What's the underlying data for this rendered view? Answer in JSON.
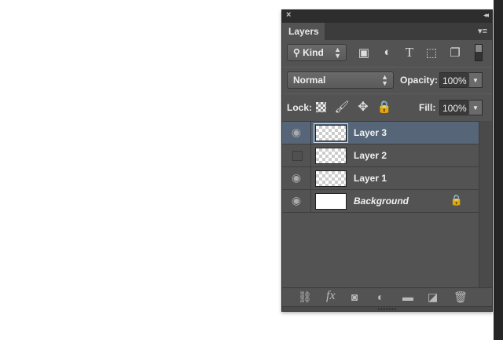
{
  "panel": {
    "close_icon": "×",
    "collapse_icon": "◂◂",
    "tab_label": "Layers",
    "menu_icon": "▾≡"
  },
  "filter": {
    "kind_label": "Kind",
    "search_icon": "⚲",
    "stepper_icon": "⬍"
  },
  "blend": {
    "mode": "Normal",
    "opacity_label": "Opacity:",
    "opacity_value": "100%"
  },
  "lock": {
    "label": "Lock:",
    "fill_label": "Fill:",
    "fill_value": "100%"
  },
  "layers": [
    {
      "name": "Layer 3",
      "visible": true,
      "active": true
    },
    {
      "name": "Layer 2",
      "visible": false,
      "active": false
    },
    {
      "name": "Layer 1",
      "visible": true,
      "active": false
    },
    {
      "name": "Background",
      "visible": true,
      "active": false,
      "locked": true
    }
  ],
  "footer": {
    "fx_label": "fx"
  }
}
